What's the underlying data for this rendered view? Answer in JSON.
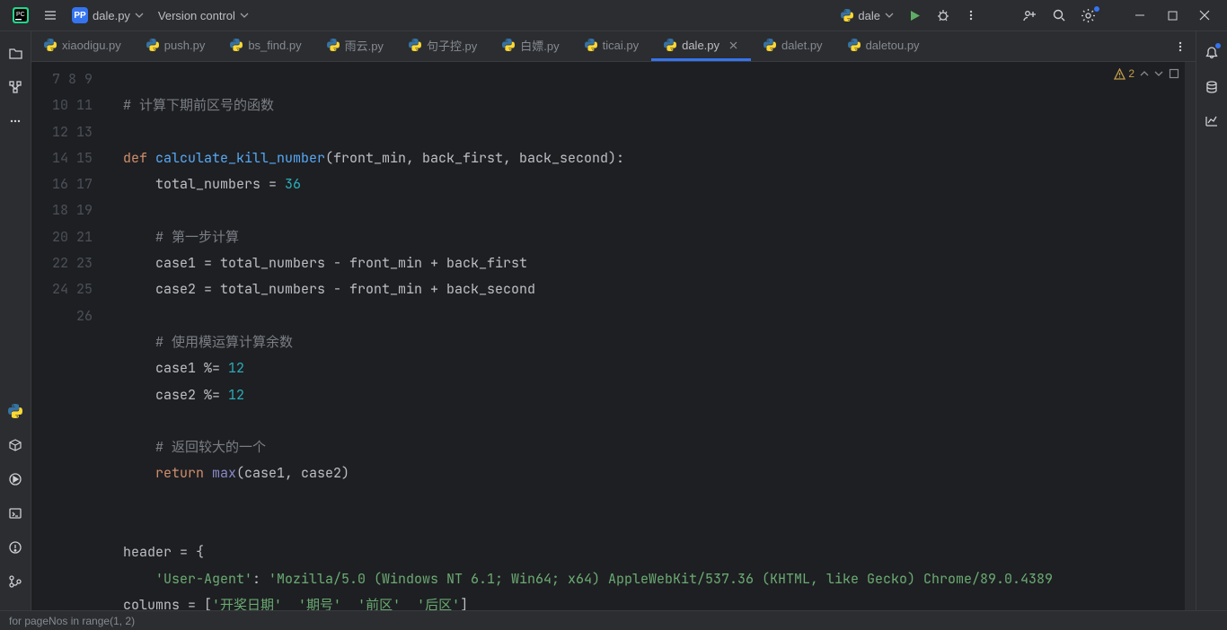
{
  "titlebar": {
    "project_badge": "PP",
    "file_dropdown": "dale.py",
    "vcs_label": "Version control",
    "run_config": "dale"
  },
  "tabs": [
    {
      "label": "xiaodigu.py",
      "active": false
    },
    {
      "label": "push.py",
      "active": false
    },
    {
      "label": "bs_find.py",
      "active": false
    },
    {
      "label": "雨云.py",
      "active": false
    },
    {
      "label": "句子控.py",
      "active": false
    },
    {
      "label": "白嫖.py",
      "active": false
    },
    {
      "label": "ticai.py",
      "active": false
    },
    {
      "label": "dale.py",
      "active": true
    },
    {
      "label": "dalet.py",
      "active": false
    },
    {
      "label": "daletou.py",
      "active": false
    }
  ],
  "inspections": {
    "warning_count": "2"
  },
  "gutter_start": 7,
  "gutter_end": 26,
  "code_lines": [
    {
      "t": ""
    },
    {
      "t": "# 计算下期前区号的函数",
      "cls": "c"
    },
    {
      "t": ""
    },
    {
      "h": "<span class='k'>def </span><span class='f'>calculate_kill_number</span>(front_min, back_first, back_second):"
    },
    {
      "h": "    total_numbers = <span class='n'>36</span>"
    },
    {
      "t": ""
    },
    {
      "h": "    <span class='c'># 第一步计算</span>"
    },
    {
      "t": "    case1 = total_numbers - front_min + back_first"
    },
    {
      "t": "    case2 = total_numbers - front_min + back_second"
    },
    {
      "t": ""
    },
    {
      "h": "    <span class='c'># 使用模运算计算余数</span>"
    },
    {
      "h": "    case1 %= <span class='n'>12</span>"
    },
    {
      "h": "    case2 %= <span class='n'>12</span>"
    },
    {
      "t": ""
    },
    {
      "h": "    <span class='c'># 返回较大的一个</span>"
    },
    {
      "h": "    <span class='k'>return </span><span class='b'>max</span>(case1, case2)"
    },
    {
      "t": ""
    },
    {
      "t": ""
    },
    {
      "t": "header = {"
    },
    {
      "h": "    <span class='s'>'User-Agent'</span>: <span class='s'>'Mozilla/5.0 (Windows NT 6.1; Win64; x64) AppleWebKit/537.36 (KHTML, like Gecko) Chrome/89.0.4389</span>"
    },
    {
      "h": "columns = [<span class='s'>'开奖日期'</span>  <span class='s'>'期号'</span>  <span class='s'>'前区'</span>  <span class='s'>'后区'</span>]"
    }
  ],
  "statusbar": {
    "breadcrumb": "for pageNos in range(1, 2)"
  }
}
